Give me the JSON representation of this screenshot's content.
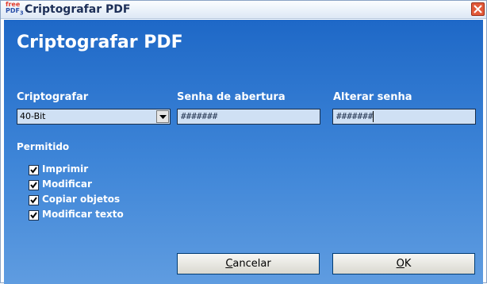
{
  "window": {
    "title": "Criptografar PDF",
    "icon_top": "free",
    "icon_bottom": "PDF",
    "icon_sub": "3",
    "close_icon": "close-icon"
  },
  "dialog": {
    "heading": "Criptografar PDF",
    "encryption": {
      "label": "Criptografar",
      "selected": "40-Bit"
    },
    "open_password": {
      "label": "Senha de abertura",
      "value": "#######"
    },
    "change_password": {
      "label": "Alterar senha",
      "value": "#######"
    },
    "permissions": {
      "label": "Permitido",
      "items": [
        {
          "label": "Imprimir",
          "checked": true
        },
        {
          "label": "Modificar",
          "checked": true
        },
        {
          "label": "Copiar objetos",
          "checked": true
        },
        {
          "label": "Modificar texto",
          "checked": true
        }
      ]
    },
    "buttons": {
      "cancel_first": "C",
      "cancel_rest": "ancelar",
      "ok_first": "O",
      "ok_rest": "K"
    }
  }
}
